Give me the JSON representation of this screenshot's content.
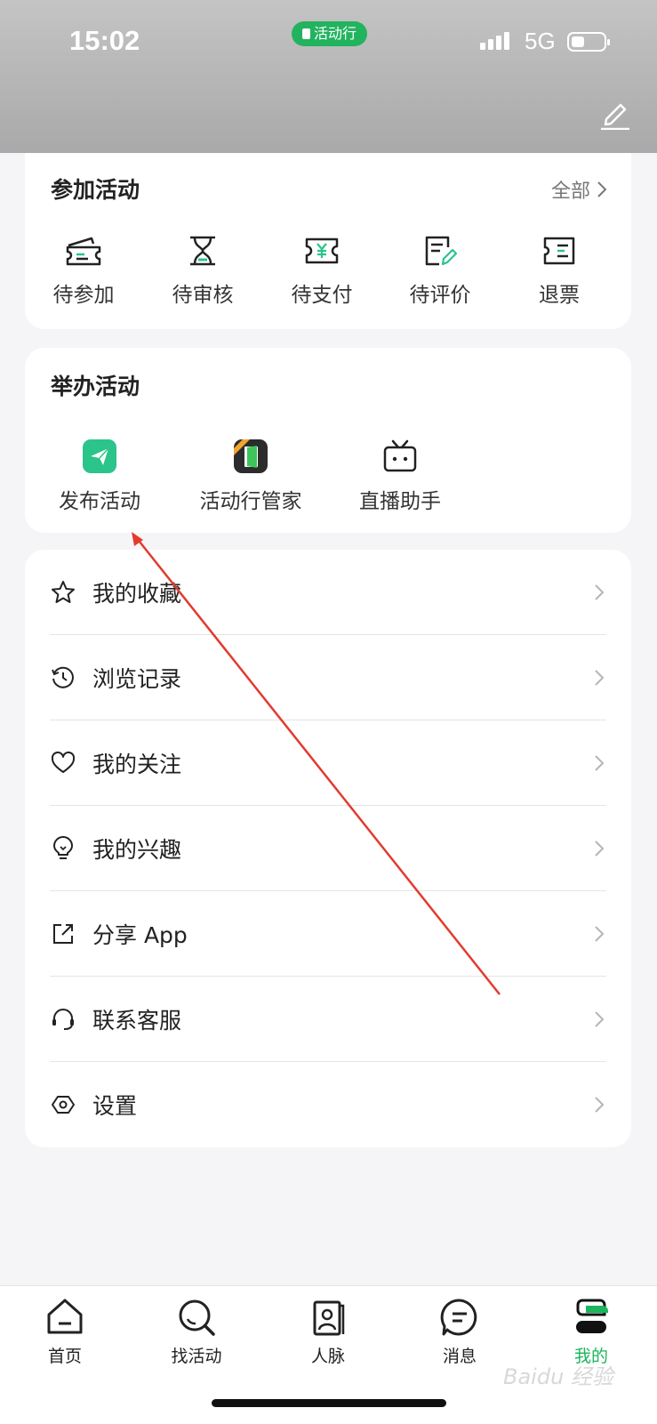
{
  "status": {
    "time": "15:02",
    "app_pill": "活动行",
    "network": "5G"
  },
  "participate": {
    "title": "参加活动",
    "more": "全部",
    "items": [
      {
        "label": "待参加",
        "icon": "ticket-icon"
      },
      {
        "label": "待审核",
        "icon": "hourglass-icon"
      },
      {
        "label": "待支付",
        "icon": "yuan-ticket-icon"
      },
      {
        "label": "待评价",
        "icon": "review-pen-icon"
      },
      {
        "label": "退票",
        "icon": "refund-ticket-icon"
      }
    ]
  },
  "host": {
    "title": "举办活动",
    "items": [
      {
        "label": "发布活动",
        "icon": "publish-plane-icon"
      },
      {
        "label": "活动行管家",
        "icon": "manager-door-icon"
      },
      {
        "label": "直播助手",
        "icon": "live-tv-icon"
      }
    ]
  },
  "menu": [
    {
      "label": "我的收藏",
      "icon": "star-icon"
    },
    {
      "label": "浏览记录",
      "icon": "history-icon"
    },
    {
      "label": "我的关注",
      "icon": "heart-icon"
    },
    {
      "label": "我的兴趣",
      "icon": "lightbulb-icon"
    },
    {
      "label": "分享 App",
      "icon": "share-icon"
    },
    {
      "label": "联系客服",
      "icon": "headset-icon"
    },
    {
      "label": "设置",
      "icon": "settings-icon"
    }
  ],
  "tabs": [
    {
      "label": "首页",
      "icon": "home-icon"
    },
    {
      "label": "找活动",
      "icon": "search-icon"
    },
    {
      "label": "人脉",
      "icon": "contacts-icon"
    },
    {
      "label": "消息",
      "icon": "message-icon"
    },
    {
      "label": "我的",
      "icon": "profile-icon",
      "active": true
    }
  ],
  "watermark": "Baidu 经验",
  "colors": {
    "accent": "#1bb55c",
    "annotation_arrow": "#e23b2e"
  }
}
